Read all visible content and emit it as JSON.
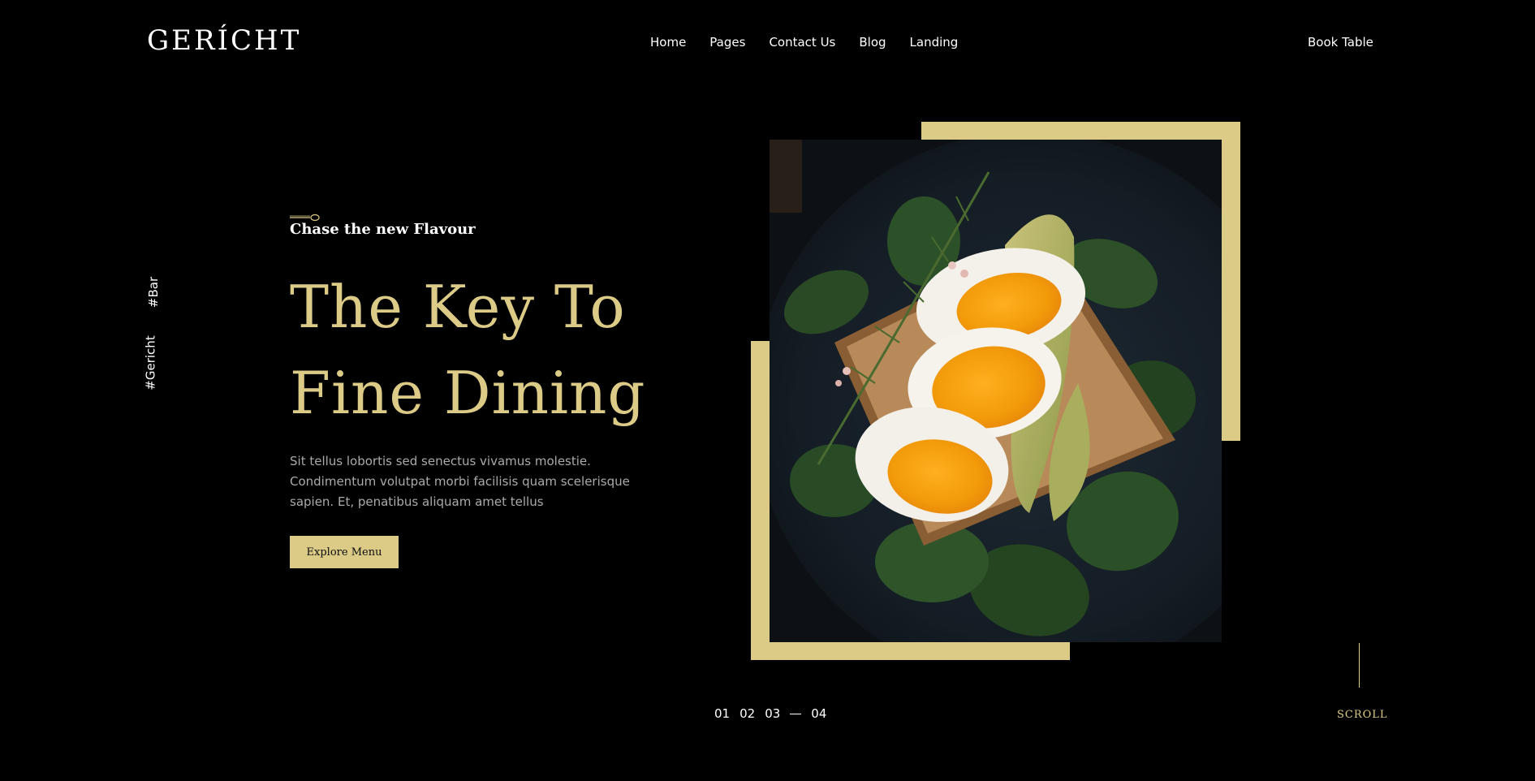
{
  "header": {
    "logo": "GERÍCHT",
    "nav": [
      "Home",
      "Pages",
      "Contact Us",
      "Blog",
      "Landing"
    ],
    "book_table": "Book Table"
  },
  "side_tags": {
    "bar": "#Bar",
    "gericht": "#Gericht"
  },
  "hero": {
    "subtitle": "Chase the new Flavour",
    "headline_line1": "The Key To",
    "headline_line2": "Fine Dining",
    "description": "Sit tellus lobortis sed senectus vivamus molestie. Condimentum volutpat morbi facilisis quam scelerisque sapien. Et, penatibus aliquam amet tellus",
    "cta": "Explore Menu"
  },
  "pager": [
    "01",
    "02",
    "03",
    "04"
  ],
  "scroll_label": "SCROLL",
  "colors": {
    "background": "#000000",
    "accent_gold": "#DCCA87",
    "text_white": "#FFFFFF",
    "text_gray": "#AAAAAA"
  },
  "icons": [
    "spoon-icon"
  ],
  "image": "hero-food-photo"
}
